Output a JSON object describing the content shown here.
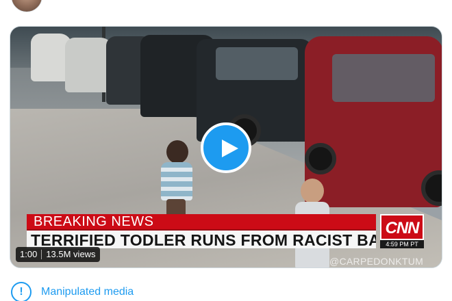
{
  "tweet": {
    "media": {
      "banner": {
        "headline_top": "BREAKING NEWS",
        "headline_bottom": "TERRIFIED TODLER RUNS FROM RACIST BABY",
        "network_logo": "CNN",
        "network_time": "4:59 PM PT"
      },
      "watermark": "@CARPEDONKTUM",
      "duration": "1:00",
      "views": "13.5M views",
      "play_icon": "play-icon"
    },
    "notice": {
      "icon": "exclamation-icon",
      "label": "Manipulated media",
      "accent_color": "#1d9bf0"
    }
  }
}
